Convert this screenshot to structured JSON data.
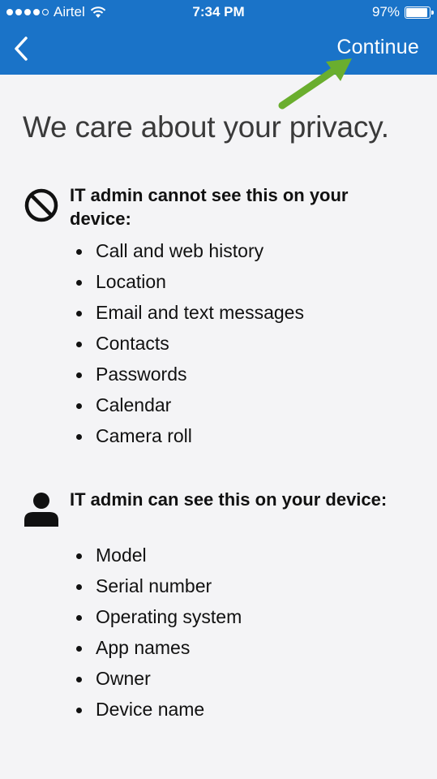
{
  "status_bar": {
    "carrier": "Airtel",
    "time": "7:34 PM",
    "battery": "97%"
  },
  "nav": {
    "continue_label": "Continue",
    "back_icon": "chevron-left-icon"
  },
  "headline": "We care about your privacy.",
  "cannot_see": {
    "title": "IT admin cannot see this on your device:",
    "icon": "prohibited-icon",
    "items": [
      "Call and web history",
      "Location",
      "Email and text messages",
      "Contacts",
      "Passwords",
      "Calendar",
      "Camera roll"
    ]
  },
  "can_see": {
    "title": "IT admin can see this on your device:",
    "icon": "person-icon",
    "items": [
      "Model",
      "Serial number",
      "Operating system",
      "App names",
      "Owner",
      "Device name"
    ]
  },
  "colors": {
    "header_bg": "#1a73c8",
    "annotation_arrow": "#6aae2e"
  }
}
